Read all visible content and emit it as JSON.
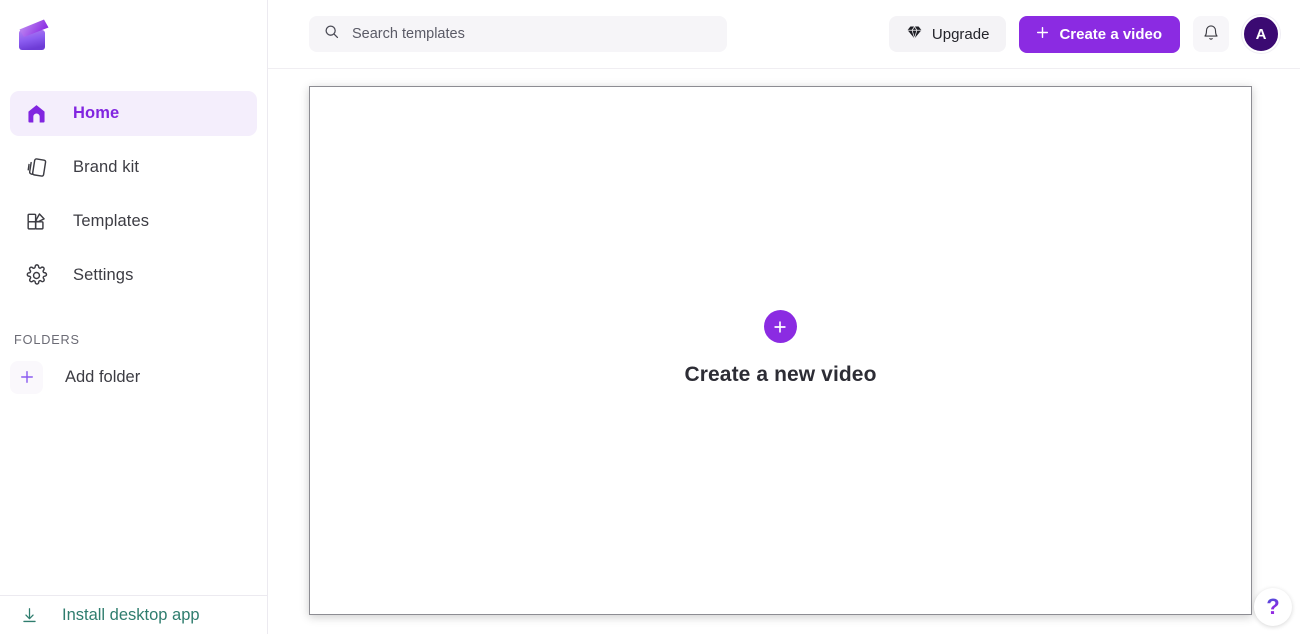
{
  "brand": {
    "logo_icon": "clapperboard-logo",
    "accent_purple": "#8b2be2",
    "active_nav_bg": "#f4eefc",
    "active_nav_text": "#8125e0",
    "avatar_bg": "#3b0a72",
    "install_link_color": "#2f7d6e"
  },
  "sidebar": {
    "items": [
      {
        "label": "Home",
        "icon": "home-icon",
        "active": true
      },
      {
        "label": "Brand kit",
        "icon": "brand-kit-icon",
        "active": false
      },
      {
        "label": "Templates",
        "icon": "templates-grid-icon",
        "active": false
      },
      {
        "label": "Settings",
        "icon": "gear-icon",
        "active": false
      }
    ],
    "folders": {
      "heading": "FOLDERS",
      "add_label": "Add folder",
      "add_icon": "plus-icon"
    },
    "footer": {
      "label": "Install desktop app",
      "icon": "download-icon"
    }
  },
  "topbar": {
    "search": {
      "placeholder": "Search templates",
      "value": "",
      "icon": "search-icon"
    },
    "upgrade": {
      "label": "Upgrade",
      "icon": "diamond-icon"
    },
    "create": {
      "label": "Create a video",
      "icon": "plus-icon"
    },
    "notifications": {
      "icon": "bell-icon"
    },
    "avatar": {
      "initial": "A"
    }
  },
  "main": {
    "empty_state": {
      "label": "Create a new video",
      "icon": "plus-circle-icon"
    },
    "help": {
      "glyph": "?",
      "name": "help-button"
    }
  }
}
